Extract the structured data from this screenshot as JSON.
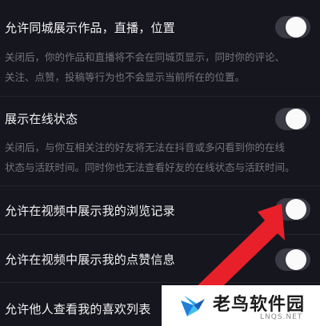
{
  "settings": [
    {
      "title": "允许同城展示作品，直播，位置",
      "desc": [
        "关闭后，你的作品和直播将不会在同城页显示，同时你的评论、",
        "关注、点赞，投稿等行为也不会显示当前所在的位置。"
      ],
      "enabled": false
    },
    {
      "title": "展示在线状态",
      "desc": [
        "关闭后，与你互相关注的好友将无法在抖音或多闪看到你的在线",
        "状态与活跃时间。同时你也无法查看好友的在线状态与活跃时间。"
      ],
      "enabled": false
    },
    {
      "title": "允许在视频中展示我的浏览记录",
      "desc": [],
      "enabled": false
    },
    {
      "title": "允许在视频中展示我的点赞信息",
      "desc": [],
      "enabled": false
    },
    {
      "title": "允许他人查看我的喜欢列表",
      "desc": [],
      "enabled": false
    }
  ],
  "watermark": {
    "name": "老鸟软件园",
    "url": "LNQS.NET",
    "icon": "bird-logo-icon"
  },
  "colors": {
    "background": "#16161e",
    "toggle_off": "#3b3b45",
    "arrow": "#e8202a"
  }
}
